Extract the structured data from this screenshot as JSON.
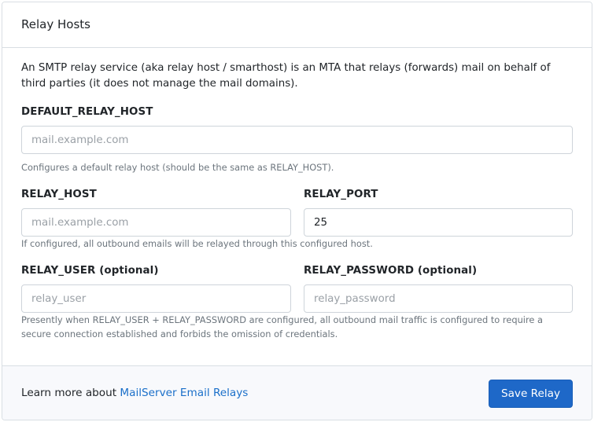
{
  "card": {
    "title": "Relay Hosts",
    "description": "An SMTP relay service (aka relay host / smarthost) is an MTA that relays (forwards) mail on behalf of third parties (it does not manage the mail domains)."
  },
  "fields": {
    "default_relay_host": {
      "label": "DEFAULT_RELAY_HOST",
      "value": "",
      "placeholder": "mail.example.com",
      "help": "Configures a default relay host (should be the same as RELAY_HOST)."
    },
    "relay_host": {
      "label": "RELAY_HOST",
      "value": "",
      "placeholder": "mail.example.com",
      "help": "If configured, all outbound emails will be relayed through this configured host."
    },
    "relay_port": {
      "label": "RELAY_PORT",
      "value": "25",
      "placeholder": ""
    },
    "relay_user": {
      "label": "RELAY_USER (optional)",
      "value": "",
      "placeholder": "relay_user"
    },
    "relay_password": {
      "label": "RELAY_PASSWORD (optional)",
      "value": "",
      "placeholder": "relay_password"
    },
    "credentials_help": "Presently when RELAY_USER + RELAY_PASSWORD are configured, all outbound mail traffic is configured to require a secure connection established and forbids the omission of credentials."
  },
  "footer": {
    "learn_more_prefix": "Learn more about ",
    "link_text": "MailServer Email Relays",
    "save_label": "Save Relay"
  },
  "colors": {
    "primary": "#1e68c8",
    "link": "#1a6fc9",
    "border": "#d9dee3",
    "muted": "#6c757d"
  }
}
